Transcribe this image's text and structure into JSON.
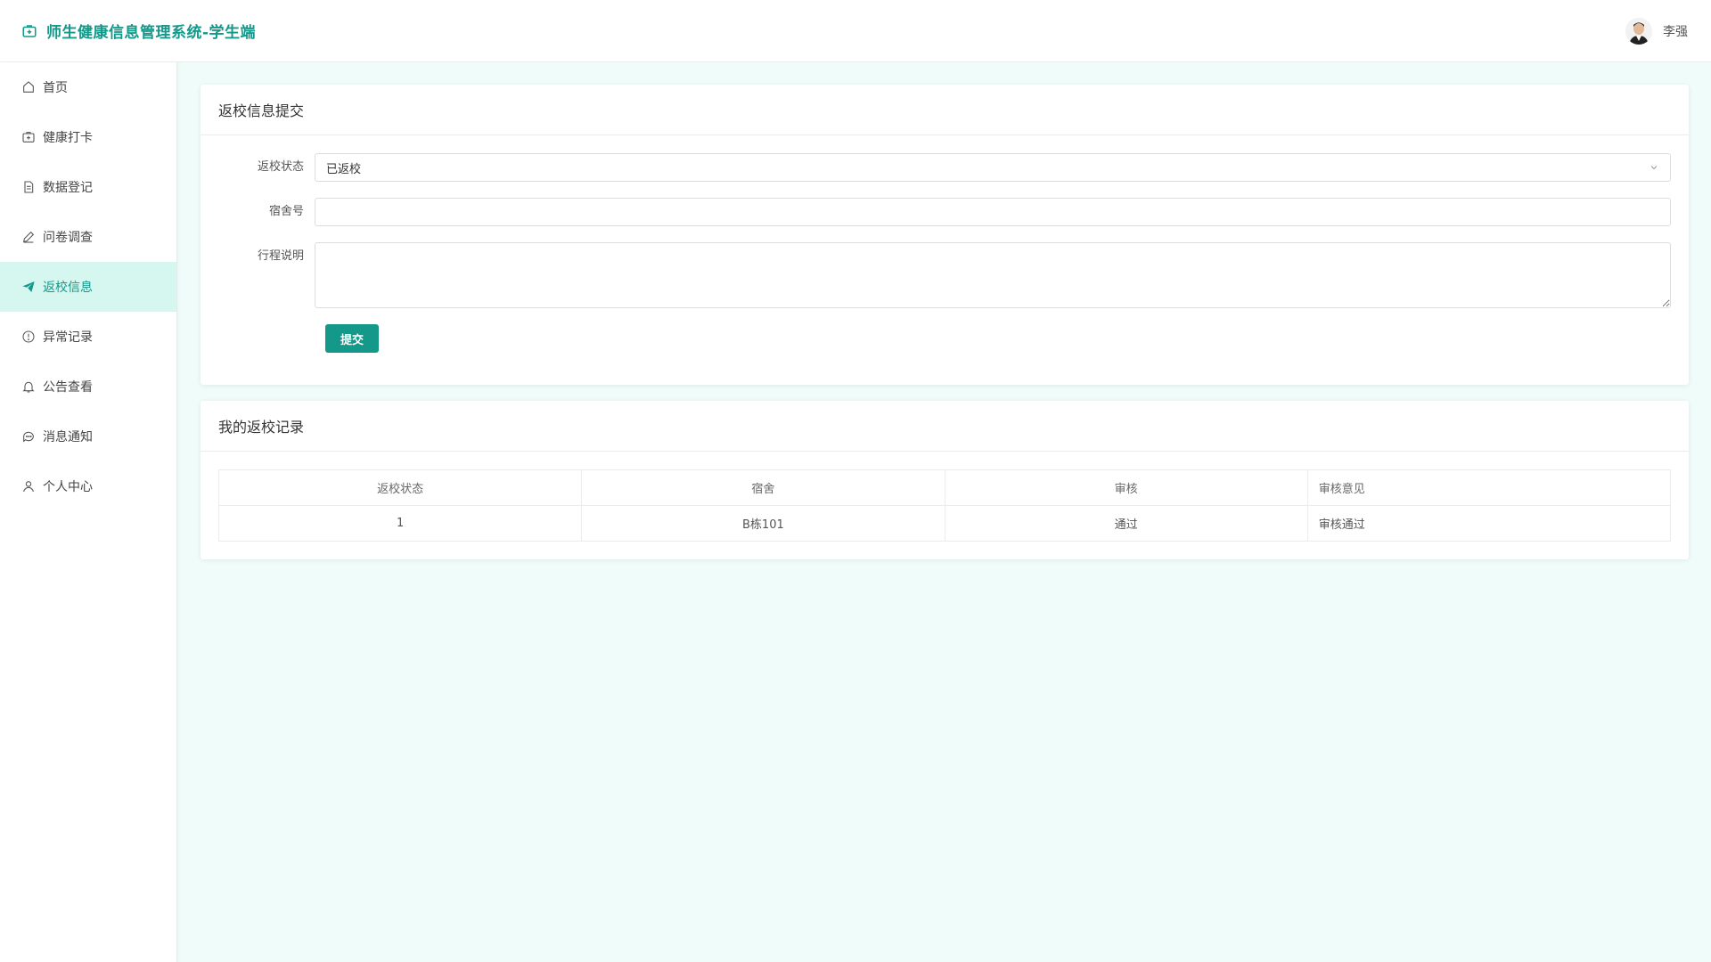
{
  "header": {
    "title": "师生健康信息管理系统-学生端",
    "user_name": "李强"
  },
  "sidebar": {
    "items": [
      {
        "label": "首页",
        "icon": "home-icon"
      },
      {
        "label": "健康打卡",
        "icon": "medical-kit-icon"
      },
      {
        "label": "数据登记",
        "icon": "document-icon"
      },
      {
        "label": "问卷调查",
        "icon": "pencil-icon"
      },
      {
        "label": "返校信息",
        "icon": "send-icon",
        "active": true
      },
      {
        "label": "异常记录",
        "icon": "alert-circle-icon"
      },
      {
        "label": "公告查看",
        "icon": "bell-icon"
      },
      {
        "label": "消息通知",
        "icon": "chat-icon"
      },
      {
        "label": "个人中心",
        "icon": "user-icon"
      }
    ]
  },
  "submit_card": {
    "title": "返校信息提交",
    "status_label": "返校状态",
    "status_value": "已返校",
    "dorm_label": "宿舍号",
    "dorm_value": "",
    "trip_label": "行程说明",
    "trip_value": "",
    "submit_label": "提交"
  },
  "records_card": {
    "title": "我的返校记录",
    "columns": [
      "返校状态",
      "宿舍",
      "审核",
      "审核意见"
    ],
    "rows": [
      [
        "1",
        "B栋101",
        "通过",
        "审核通过"
      ]
    ]
  },
  "colors": {
    "accent": "#13988a",
    "active_bg": "#d6f7ef",
    "page_bg": "#f0fcf9"
  }
}
